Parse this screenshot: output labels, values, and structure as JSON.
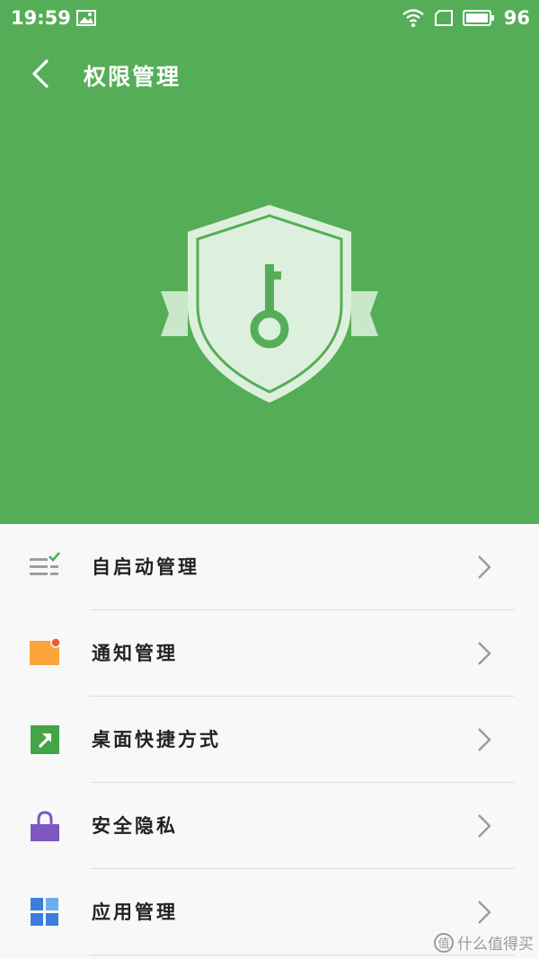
{
  "status_bar": {
    "time": "19:59",
    "battery": "96"
  },
  "header": {
    "title": "权限管理",
    "background": "#55ae57"
  },
  "menu": [
    {
      "label": "自启动管理",
      "icon": "autostart-list-icon"
    },
    {
      "label": "通知管理",
      "icon": "notification-icon"
    },
    {
      "label": "桌面快捷方式",
      "icon": "shortcut-icon"
    },
    {
      "label": "安全隐私",
      "icon": "lock-icon"
    },
    {
      "label": "应用管理",
      "icon": "app-grid-icon"
    }
  ],
  "watermark": {
    "text": "什么值得买",
    "logo": "值"
  }
}
